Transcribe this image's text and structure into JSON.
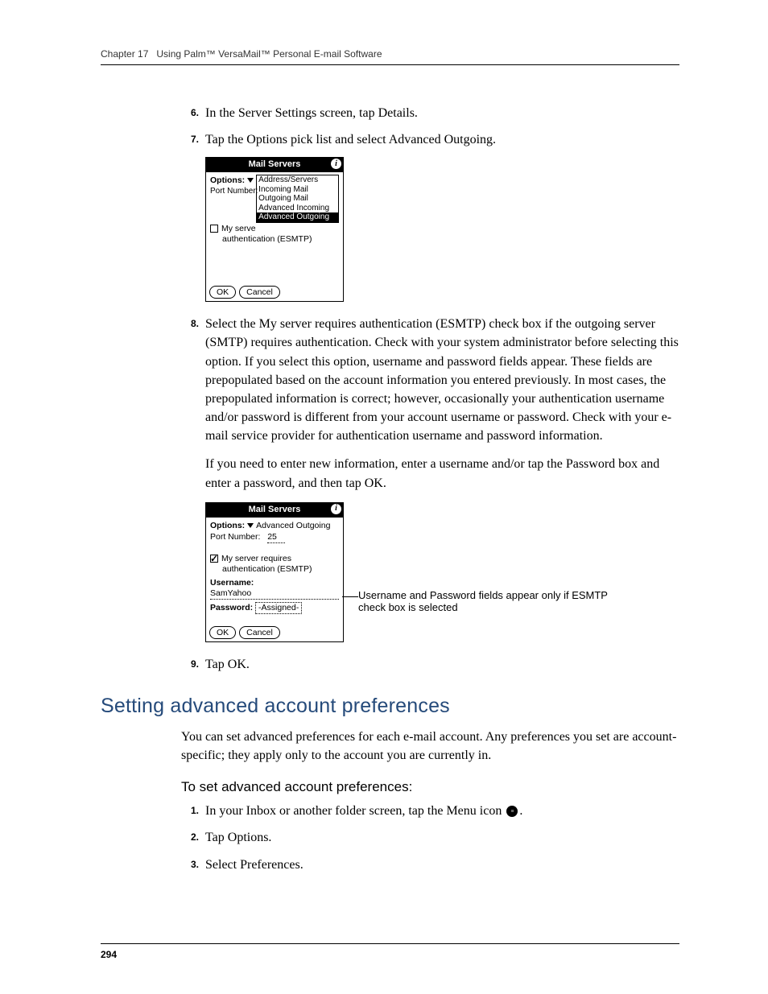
{
  "header": {
    "chapter": "Chapter 17",
    "title": "Using Palm™ VersaMail™ Personal E-mail Software"
  },
  "steps_top": [
    {
      "n": "6.",
      "text": "In the Server Settings screen, tap Details."
    },
    {
      "n": "7.",
      "text": "Tap the Options pick list and select Advanced Outgoing."
    }
  ],
  "fig1": {
    "title": "Mail Servers",
    "options_label": "Options:",
    "port_label": "Port Number:",
    "port_side": "Incoming Mail",
    "dropdown": [
      "Address/Servers",
      "Incoming Mail",
      "Outgoing Mail",
      "Advanced Incoming",
      "Advanced Outgoing"
    ],
    "check_row": "My serve",
    "auth_line": "authentication (ESMTP)",
    "ok": "OK",
    "cancel": "Cancel"
  },
  "step8": {
    "n": "8.",
    "text": "Select the My server requires authentication (ESMTP) check box if the outgoing server (SMTP) requires authentication. Check with your system administrator before selecting this option. If you select this option, username and password fields appear. These fields are prepopulated based on the account information you entered previously. In most cases, the prepopulated information is correct; however, occasionally your authentication username and/or password is different from your account username or password. Check with your e-mail service provider for authentication username and password information."
  },
  "para_after8": "If you need to enter new information, enter a username and/or tap the Password box and enter a password, and then tap OK.",
  "fig2": {
    "title": "Mail Servers",
    "options_label": "Options:",
    "options_value": "Advanced Outgoing",
    "port_label": "Port Number:",
    "port_value": "25",
    "check_line1": "My server requires",
    "check_line2": "authentication (ESMTP)",
    "username_label": "Username:",
    "username_value": "SamYahoo",
    "password_label": "Password:",
    "password_value": "-Assigned-",
    "ok": "OK",
    "cancel": "Cancel"
  },
  "callout": "Username and Password fields appear only if ESMTP check box is selected",
  "step9": {
    "n": "9.",
    "text": "Tap OK."
  },
  "section_title": "Setting advanced account preferences",
  "section_intro": "You can set advanced preferences for each e-mail account. Any preferences you set are account-specific; they apply only to the account you are currently in.",
  "subhead": "To set advanced account preferences:",
  "steps_bottom": [
    {
      "n": "1.",
      "pre": "In your Inbox or another folder screen, tap the Menu icon ",
      "post": "."
    },
    {
      "n": "2.",
      "text": "Tap Options."
    },
    {
      "n": "3.",
      "text": "Select Preferences."
    }
  ],
  "page_number": "294"
}
